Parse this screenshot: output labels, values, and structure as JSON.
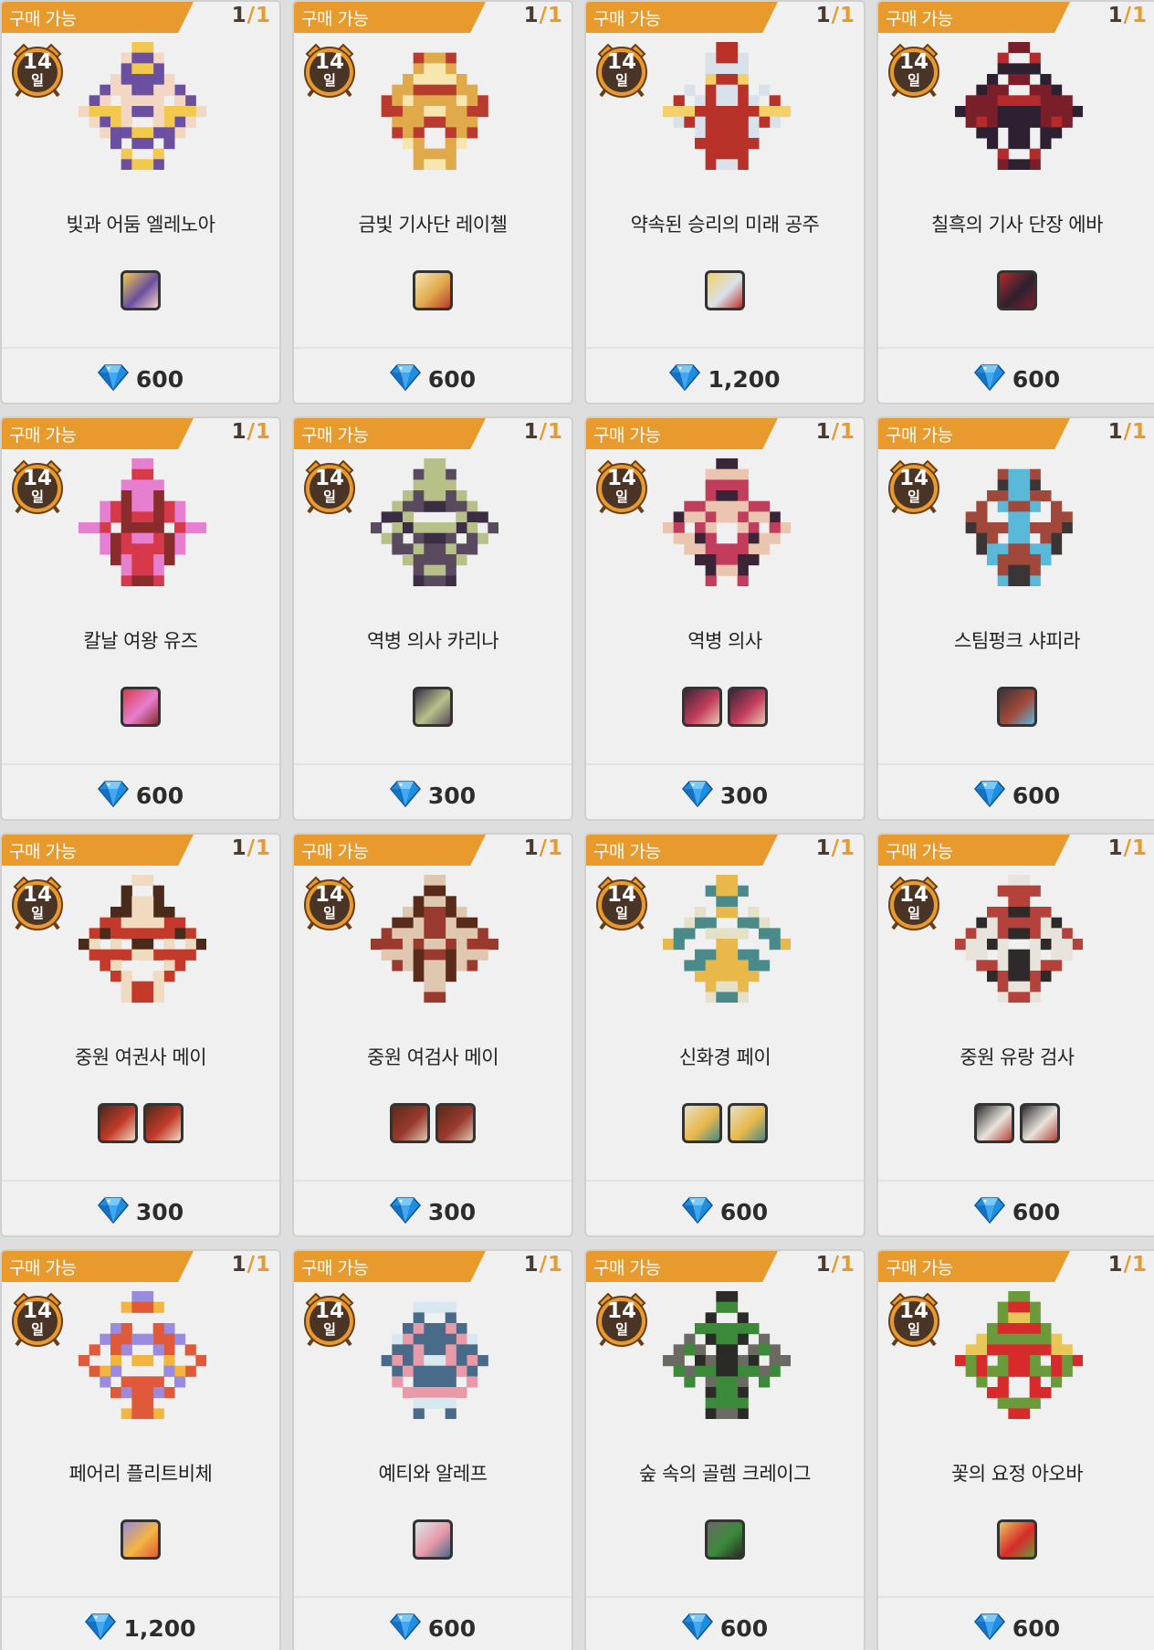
{
  "status_label": "구매 가능",
  "duration": {
    "value": "14",
    "unit": "일"
  },
  "stock": {
    "current": "1",
    "separator": "/",
    "max": "1"
  },
  "gem_icon": "blue-gem-icon",
  "colors": {
    "banner": "#e99a2c",
    "gem": "#1e8fe0",
    "card_bg": "#f0f0f0"
  },
  "items": [
    {
      "name": "빛과 어둠 엘레노아",
      "price": "600",
      "hero_icons": 1,
      "palette": [
        "#f2c94c",
        "#6b4fa0",
        "#f4d7c2"
      ]
    },
    {
      "name": "금빛 기사단 레이첼",
      "price": "600",
      "hero_icons": 1,
      "palette": [
        "#f7e6b0",
        "#e0a94a",
        "#b93b2f"
      ]
    },
    {
      "name": "약속된 승리의 미래 공주",
      "price": "1,200",
      "hero_icons": 1,
      "palette": [
        "#f3d06a",
        "#d9e1ea",
        "#b8322a"
      ]
    },
    {
      "name": "칠흑의 기사 단장 에바",
      "price": "600",
      "hero_icons": 1,
      "palette": [
        "#b52a2a",
        "#2d2030",
        "#7a1f2a"
      ]
    },
    {
      "name": "칼날 여왕 유즈",
      "price": "600",
      "hero_icons": 1,
      "palette": [
        "#d63a4a",
        "#e77fd0",
        "#8a2c2c"
      ]
    },
    {
      "name": "역병 의사 카리나",
      "price": "300",
      "hero_icons": 1,
      "palette": [
        "#3a2e45",
        "#b8c08a",
        "#5a4a5f"
      ]
    },
    {
      "name": "역병 의사",
      "price": "300",
      "hero_icons": 2,
      "palette": [
        "#3a2438",
        "#c23d5c",
        "#eac6b0"
      ]
    },
    {
      "name": "스팀펑크 샤피라",
      "price": "600",
      "hero_icons": 1,
      "palette": [
        "#3b3535",
        "#a2483a",
        "#5ab8d8"
      ]
    },
    {
      "name": "중원 여권사 메이",
      "price": "300",
      "hero_icons": 2,
      "palette": [
        "#4a2a1a",
        "#c43a2a",
        "#f0dac0"
      ]
    },
    {
      "name": "중원 여검사 메이",
      "price": "300",
      "hero_icons": 2,
      "palette": [
        "#5a2a1a",
        "#9a3a2e",
        "#e0c8b0"
      ]
    },
    {
      "name": "신화경 페이",
      "price": "600",
      "hero_icons": 2,
      "palette": [
        "#e5e0c8",
        "#e8b84a",
        "#4a8a8a"
      ]
    },
    {
      "name": "중원 유랑 검사",
      "price": "600",
      "hero_icons": 2,
      "palette": [
        "#2e2a2a",
        "#e8e4dc",
        "#b5423a"
      ]
    },
    {
      "name": "페어리 플리트비체",
      "price": "1,200",
      "hero_icons": 1,
      "palette": [
        "#9a8ae0",
        "#f2b640",
        "#e05a3a"
      ]
    },
    {
      "name": "예티와 알레프",
      "price": "600",
      "hero_icons": 1,
      "palette": [
        "#d8e8f0",
        "#e89aa8",
        "#4a6a8a"
      ]
    },
    {
      "name": "숲 속의 골렘 크레이그",
      "price": "600",
      "hero_icons": 1,
      "palette": [
        "#6a6a62",
        "#3a8a3a",
        "#2a2a26"
      ]
    },
    {
      "name": "꽃의 요정 아오바",
      "price": "600",
      "hero_icons": 1,
      "palette": [
        "#e8c65a",
        "#d82a2a",
        "#6a9a3a"
      ]
    }
  ]
}
